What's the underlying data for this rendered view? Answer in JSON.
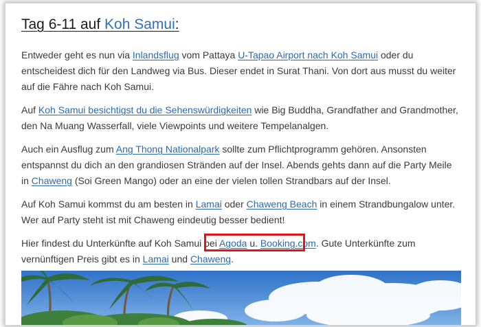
{
  "heading": {
    "prefix": "Tag 6-11 auf ",
    "link": "Koh Samui",
    "suffix": ":"
  },
  "p1": {
    "t1": "Entweder geht es nun via ",
    "l1": "Inlandsflug",
    "t2": " vom Pattaya ",
    "l2": "U-Tapao Airport nach Koh Samui",
    "t3": " oder du entscheidest dich für den Landweg via Bus. Dieser endet in Surat Thani. Von dort aus musst du weiter auf die Fähre nach Koh Samui."
  },
  "p2": {
    "t1": "Auf ",
    "l1": "Koh Samui besichtigst du die Sehenswürdigkeiten",
    "t2": " wie Big Buddha, Grandfather and Grandmother, den Na Muang Wasserfall, viele Viewpoints und weitere Tempelanalgen."
  },
  "p3": {
    "t1": "Auch ein Ausflug zum ",
    "l1": "Ang Thong Nationalpark",
    "t2": " sollte zum Pflichtprogramm gehören. Ansonsten entspannst du dich an den grandiosen Stränden auf der Insel. Abends gehts dann auf die Party Meile in ",
    "l2": "Chaweng",
    "t3": " (Soi Green Mango) oder an eine der vielen tollen Strandbars auf der Insel."
  },
  "p4": {
    "t1": "Auf Koh Samui kommst du am besten in ",
    "l1": "Lamai",
    "t2": " oder ",
    "l2": "Chaweng Beach",
    "t3": " in einem Strandbungalow unter. Wer auf Party steht ist mit Chaweng eindeutig besser bedient!"
  },
  "p5": {
    "t1": "Hier findest du Unterkünfte auf Koh Samui bei ",
    "l1": "Agoda",
    "t2": " u. ",
    "l2": "Booking.com",
    "t3": ". Gute Unterkünfte zum vernünftigen Preis gibt es in ",
    "l3": "Lamai",
    "t4": " und ",
    "l4": "Chaweng",
    "t5": "."
  },
  "colors": {
    "link": "#2a6ab3",
    "highlight": "#e0141b",
    "text": "#3a3a3a"
  },
  "image": {
    "subject": "palm-trees-beach-photo"
  }
}
